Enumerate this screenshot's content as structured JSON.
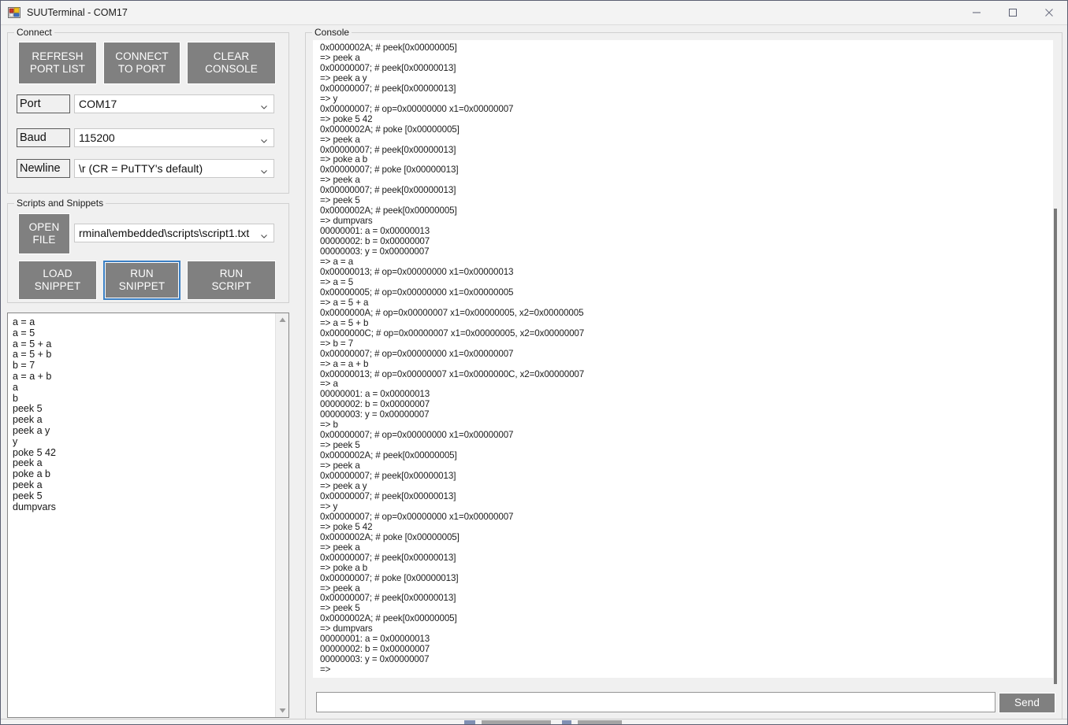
{
  "window": {
    "title": "SUUTerminal - COM17",
    "icon": "app-icon",
    "minimize_label": "—",
    "maximize_label": "□",
    "close_label": "×"
  },
  "connect_group": {
    "legend": "Connect",
    "buttons": {
      "refresh_port_list": "REFRESH\nPORT LIST",
      "connect_to_port": "CONNECT\nTO PORT",
      "clear_console": "CLEAR\nCONSOLE"
    },
    "fields": [
      {
        "label": "Port",
        "value": "COM17"
      },
      {
        "label": "Baud",
        "value": "115200"
      },
      {
        "label": "Newline",
        "value": "\\r (CR = PuTTY's default)"
      }
    ]
  },
  "scripts_group": {
    "legend": "Scripts and Snippets",
    "buttons": {
      "open_file": "OPEN\nFILE",
      "load_snippet": "LOAD\nSNIPPET",
      "run_snippet": "RUN\nSNIPPET",
      "run_script": "RUN\nSCRIPT"
    },
    "script_path": "rminal\\embedded\\scripts\\script1.txt"
  },
  "snippet_editor": {
    "content": "a = a\na = 5\na = 5 + a\na = 5 + b\nb = 7\na = a + b\na\nb\npeek 5\npeek a\npeek a y\ny\npoke 5 42\npeek a\npoke a b\npeek a\npeek 5\ndumpvars"
  },
  "console_group": {
    "legend": "Console",
    "output": "0x0000002A; # peek[0x00000005]\n=> peek a\n0x00000007; # peek[0x00000013]\n=> peek a y\n0x00000007; # peek[0x00000013]\n=> y\n0x00000007; # op=0x00000000 x1=0x00000007\n=> poke 5 42\n0x0000002A; # poke [0x00000005]\n=> peek a\n0x00000007; # peek[0x00000013]\n=> poke a b\n0x00000007; # poke [0x00000013]\n=> peek a\n0x00000007; # peek[0x00000013]\n=> peek 5\n0x0000002A; # peek[0x00000005]\n=> dumpvars\n00000001: a = 0x00000013\n00000002: b = 0x00000007\n00000003: y = 0x00000007\n=> a = a\n0x00000013; # op=0x00000000 x1=0x00000013\n=> a = 5\n0x00000005; # op=0x00000000 x1=0x00000005\n=> a = 5 + a\n0x0000000A; # op=0x00000007 x1=0x00000005, x2=0x00000005\n=> a = 5 + b\n0x0000000C; # op=0x00000007 x1=0x00000005, x2=0x00000007\n=> b = 7\n0x00000007; # op=0x00000000 x1=0x00000007\n=> a = a + b\n0x00000013; # op=0x00000007 x1=0x0000000C, x2=0x00000007\n=> a\n00000001: a = 0x00000013\n00000002: b = 0x00000007\n00000003: y = 0x00000007\n=> b\n0x00000007; # op=0x00000000 x1=0x00000007\n=> peek 5\n0x0000002A; # peek[0x00000005]\n=> peek a\n0x00000007; # peek[0x00000013]\n=> peek a y\n0x00000007; # peek[0x00000013]\n=> y\n0x00000007; # op=0x00000000 x1=0x00000007\n=> poke 5 42\n0x0000002A; # poke [0x00000005]\n=> peek a\n0x00000007; # peek[0x00000013]\n=> poke a b\n0x00000007; # poke [0x00000013]\n=> peek a\n0x00000007; # peek[0x00000013]\n=> peek 5\n0x0000002A; # peek[0x00000005]\n=> dumpvars\n00000001: a = 0x00000013\n00000002: b = 0x00000007\n00000003: y = 0x00000007\n=>",
    "input_value": "",
    "input_placeholder": "",
    "send_label": "Send"
  },
  "colors": {
    "button_face": "#808080",
    "button_text": "#ffffff",
    "focus_outline": "#3a7fc4",
    "window_background": "#f0f0f0",
    "field_background": "#ffffff"
  }
}
